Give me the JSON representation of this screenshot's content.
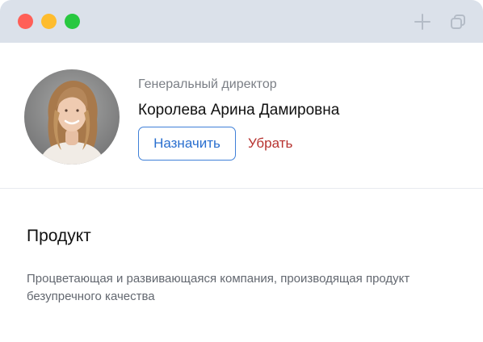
{
  "window": {
    "controls": [
      "close",
      "minimize",
      "maximize"
    ],
    "actions": [
      "add-icon",
      "duplicate-icon"
    ]
  },
  "profile": {
    "role": "Генеральный директор",
    "name": "Королева Арина Дамировна",
    "assign_label": "Назначить",
    "remove_label": "Убрать",
    "avatar": "woman-portrait"
  },
  "section": {
    "title": "Продукт",
    "text": "Процветающая и развивающаяся компания, производящая продукт безупречного качества"
  },
  "colors": {
    "titlebar": "#dbe1ea",
    "accent": "#2a6fcf",
    "danger": "#b7322f",
    "muted": "#7b7f86"
  }
}
